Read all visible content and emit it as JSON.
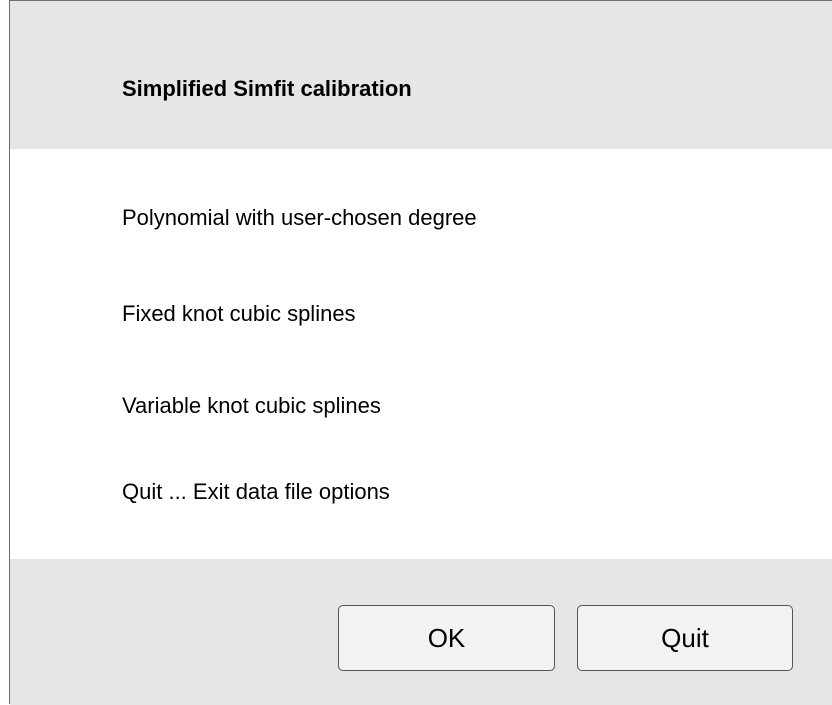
{
  "dialog": {
    "title": "Simplified Simfit calibration"
  },
  "options": [
    {
      "label": "Polynomial with user-chosen degree"
    },
    {
      "label": "Fixed knot cubic splines"
    },
    {
      "label": "Variable knot cubic splines"
    },
    {
      "label": "Quit ... Exit data file options"
    }
  ],
  "buttons": {
    "ok_label": "OK",
    "quit_label": "Quit"
  },
  "colors": {
    "panel_gray": "#e6e6e6",
    "content_white": "#ffffff",
    "border": "#555555"
  }
}
